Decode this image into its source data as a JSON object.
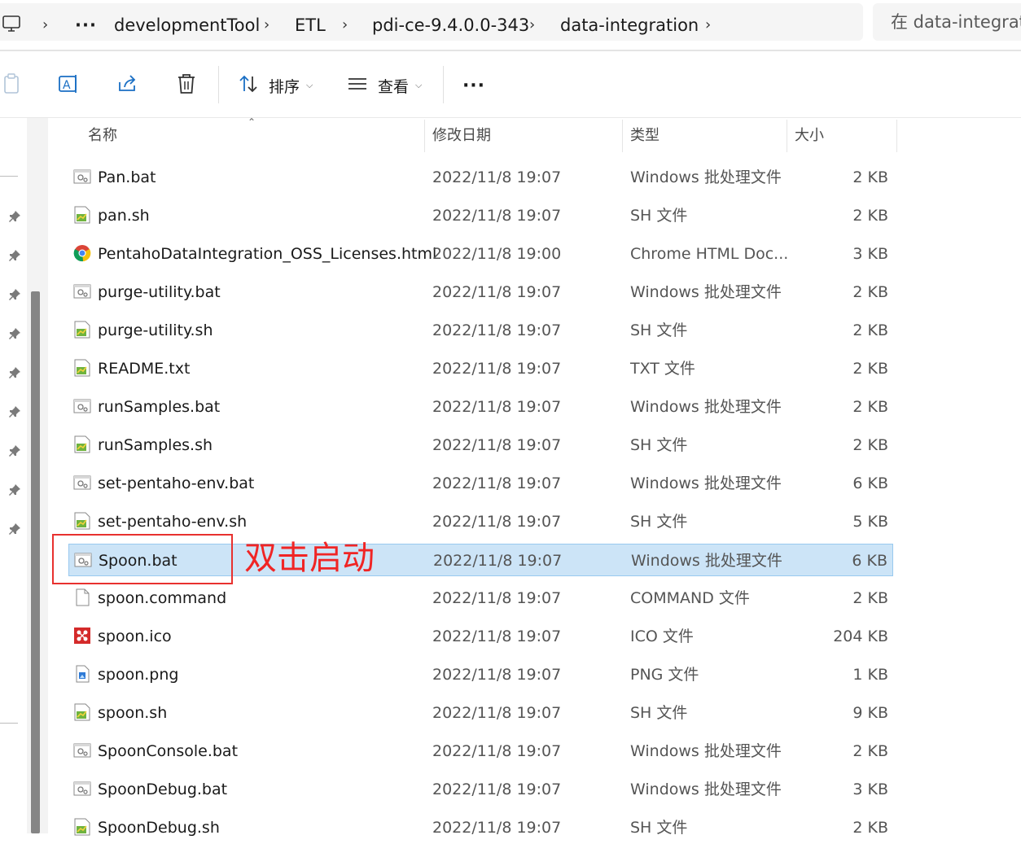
{
  "address_bar": {
    "more_label": "···",
    "crumbs": [
      "developmentTool",
      "ETL",
      "pdi-ce-9.4.0.0-343",
      "data-integration"
    ],
    "search_placeholder": "在 data-integration 中搜索"
  },
  "toolbar": {
    "sort_label": "排序",
    "view_label": "查看",
    "more_label": "···"
  },
  "columns": {
    "name": "名称",
    "modified": "修改日期",
    "type": "类型",
    "size": "大小"
  },
  "files": [
    {
      "name": "Pan.bat",
      "date": "2022/11/8 19:07",
      "type": "Windows 批处理文件",
      "size": "2 KB",
      "icon": "bat-file-icon"
    },
    {
      "name": "pan.sh",
      "date": "2022/11/8 19:07",
      "type": "SH 文件",
      "size": "2 KB",
      "icon": "sh-file-icon"
    },
    {
      "name": "PentahoDataIntegration_OSS_Licenses.html",
      "date": "2022/11/8 19:00",
      "type": "Chrome HTML Doc...",
      "size": "3 KB",
      "icon": "chrome-html-icon"
    },
    {
      "name": "purge-utility.bat",
      "date": "2022/11/8 19:07",
      "type": "Windows 批处理文件",
      "size": "2 KB",
      "icon": "bat-file-icon"
    },
    {
      "name": "purge-utility.sh",
      "date": "2022/11/8 19:07",
      "type": "SH 文件",
      "size": "2 KB",
      "icon": "sh-file-icon"
    },
    {
      "name": "README.txt",
      "date": "2022/11/8 19:07",
      "type": "TXT 文件",
      "size": "2 KB",
      "icon": "sh-file-icon"
    },
    {
      "name": "runSamples.bat",
      "date": "2022/11/8 19:07",
      "type": "Windows 批处理文件",
      "size": "2 KB",
      "icon": "bat-file-icon"
    },
    {
      "name": "runSamples.sh",
      "date": "2022/11/8 19:07",
      "type": "SH 文件",
      "size": "2 KB",
      "icon": "sh-file-icon"
    },
    {
      "name": "set-pentaho-env.bat",
      "date": "2022/11/8 19:07",
      "type": "Windows 批处理文件",
      "size": "6 KB",
      "icon": "bat-file-icon"
    },
    {
      "name": "set-pentaho-env.sh",
      "date": "2022/11/8 19:07",
      "type": "SH 文件",
      "size": "5 KB",
      "icon": "sh-file-icon"
    },
    {
      "name": "Spoon.bat",
      "date": "2022/11/8 19:07",
      "type": "Windows 批处理文件",
      "size": "6 KB",
      "icon": "bat-file-icon",
      "selected": true
    },
    {
      "name": "spoon.command",
      "date": "2022/11/8 19:07",
      "type": "COMMAND 文件",
      "size": "2 KB",
      "icon": "blank-file-icon"
    },
    {
      "name": "spoon.ico",
      "date": "2022/11/8 19:07",
      "type": "ICO 文件",
      "size": "204 KB",
      "icon": "ico-file-icon"
    },
    {
      "name": "spoon.png",
      "date": "2022/11/8 19:07",
      "type": "PNG 文件",
      "size": "1 KB",
      "icon": "png-file-icon"
    },
    {
      "name": "spoon.sh",
      "date": "2022/11/8 19:07",
      "type": "SH 文件",
      "size": "9 KB",
      "icon": "sh-file-icon"
    },
    {
      "name": "SpoonConsole.bat",
      "date": "2022/11/8 19:07",
      "type": "Windows 批处理文件",
      "size": "2 KB",
      "icon": "bat-file-icon"
    },
    {
      "name": "SpoonDebug.bat",
      "date": "2022/11/8 19:07",
      "type": "Windows 批处理文件",
      "size": "3 KB",
      "icon": "bat-file-icon"
    },
    {
      "name": "SpoonDebug.sh",
      "date": "2022/11/8 19:07",
      "type": "SH 文件",
      "size": "2 KB",
      "icon": "sh-file-icon"
    }
  ],
  "annotation": {
    "text": "双击启动",
    "color": "#f02525"
  },
  "colors": {
    "selection": "#cce4f7",
    "selection_border": "#99c9ef",
    "annotation_border": "#e8312f"
  }
}
